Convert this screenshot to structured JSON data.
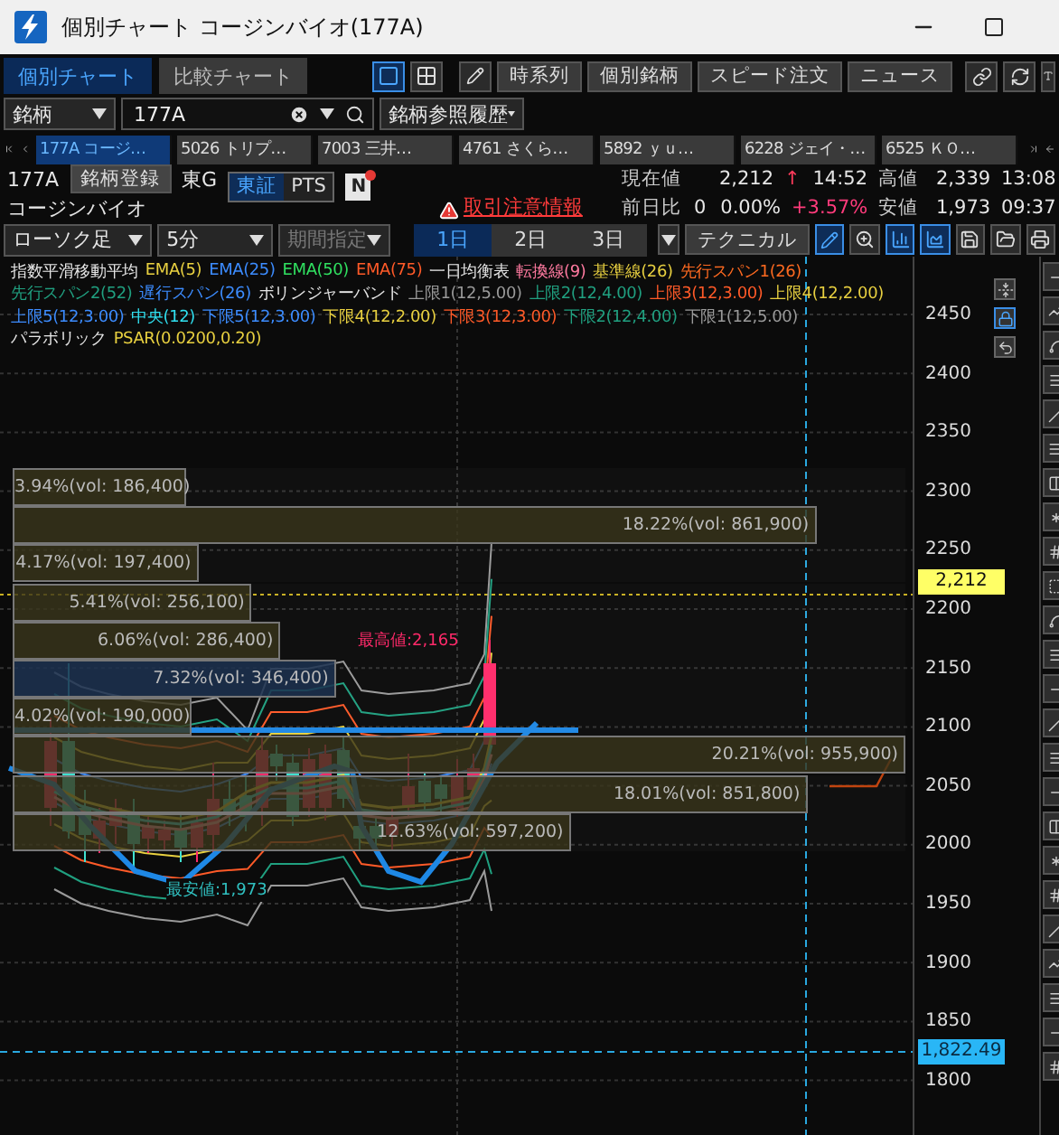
{
  "window": {
    "title": "個別チャート コージンバイオ(177A)"
  },
  "view_tabs": [
    {
      "label": "個別チャート",
      "selected": true
    },
    {
      "label": "比較チャート",
      "selected": false
    }
  ],
  "layout_modes": [
    {
      "kind": "single",
      "selected": true
    },
    {
      "kind": "grid",
      "selected": false
    }
  ],
  "toolbar_buttons": [
    "時系列",
    "個別銘柄",
    "スピード注文",
    "ニュース"
  ],
  "symbol_bar": {
    "search_type": "銘柄",
    "symbol": "177A",
    "history": "銘柄参照履歴"
  },
  "stock_tabs": [
    {
      "label": "177A コージ…",
      "selected": true
    },
    {
      "label": "5026 トリプ…",
      "selected": false
    },
    {
      "label": "7003 三井…",
      "selected": false
    },
    {
      "label": "4761 さくら…",
      "selected": false
    },
    {
      "label": "5892 ｙｕ…",
      "selected": false
    },
    {
      "label": "6228 ジェイ・…",
      "selected": false
    },
    {
      "label": "6525 ＫＯ…",
      "selected": false
    }
  ],
  "quote": {
    "code": "177A",
    "register_button": "銘柄登録",
    "market": "東G",
    "exchanges": [
      {
        "label": "東証",
        "selected": true
      },
      {
        "label": "PTS",
        "selected": false
      }
    ],
    "news_badge": "N",
    "name": "コージンバイオ",
    "notice": "取引注意情報",
    "price": {
      "label": "現在値",
      "value": "2,212",
      "arrow": "↑",
      "time": "14:52"
    },
    "high": {
      "label": "高値",
      "value": "2,339",
      "time": "13:08"
    },
    "change": {
      "label": "前日比",
      "value": "0",
      "percent": "0.00%",
      "rate": "+3.57%"
    },
    "low": {
      "label": "安値",
      "value": "1,973",
      "time": "09:37"
    }
  },
  "chart_controls": {
    "chart_type": "ローソク足",
    "interval": "5分",
    "period": {
      "label": "期間指定",
      "disabled": true
    },
    "ranges": [
      {
        "label": "1日",
        "selected": true
      },
      {
        "label": "2日",
        "selected": false
      },
      {
        "label": "3日",
        "selected": false
      }
    ],
    "technical": "テクニカル"
  },
  "legend_rows": [
    [
      {
        "text": "指数平滑移動平均",
        "color": "#e6e6e6"
      },
      {
        "text": "EMA(5)",
        "color": "#e8d040"
      },
      {
        "text": "EMA(25)",
        "color": "#3c8cff"
      },
      {
        "text": "EMA(50)",
        "color": "#30e060"
      },
      {
        "text": "EMA(75)",
        "color": "#ff5a28"
      },
      {
        "text": "一日均衡表",
        "color": "#e6e6e6"
      },
      {
        "text": "転換線(9)",
        "color": "#ff7aa0"
      },
      {
        "text": "基準線(26)",
        "color": "#e8d040"
      },
      {
        "text": "先行スパン1(26)",
        "color": "#ff6a20"
      }
    ],
    [
      {
        "text": "先行スパン2(52)",
        "color": "#20a080"
      },
      {
        "text": "遅行スパン(26)",
        "color": "#3c8cff"
      },
      {
        "text": "ボリンジャーバンド",
        "color": "#e6e6e6"
      },
      {
        "text": "上限1(12,5.00)",
        "color": "#9a9a9a"
      },
      {
        "text": "上限2(12,4.00)",
        "color": "#20a080"
      },
      {
        "text": "上限3(12,3.00)",
        "color": "#ff5a28"
      },
      {
        "text": "上限4(12,2.00)",
        "color": "#e8d040"
      }
    ],
    [
      {
        "text": "上限5(12,3.00)",
        "color": "#3c8cff"
      },
      {
        "text": "中央(12)",
        "color": "#30e0f0"
      },
      {
        "text": "下限5(12,3.00)",
        "color": "#3c8cff"
      },
      {
        "text": "下限4(12,2.00)",
        "color": "#e8d040"
      },
      {
        "text": "下限3(12,3.00)",
        "color": "#ff5a28"
      },
      {
        "text": "下限2(12,4.00)",
        "color": "#20a080"
      },
      {
        "text": "下限1(12,5.00)",
        "color": "#9a9a9a"
      }
    ],
    [
      {
        "text": "パラボリック",
        "color": "#e6e6e6"
      },
      {
        "text": "PSAR(0.0200,0.20)",
        "color": "#e8d040"
      }
    ]
  ],
  "price_axis": [
    "2450",
    "2400",
    "2350",
    "2300",
    "2250",
    "2200",
    "2150",
    "2100",
    "2050",
    "2000",
    "1950",
    "1900",
    "1850",
    "1800"
  ],
  "volume_profile": [
    {
      "label": "3.94%(vol: 186,400)",
      "level": 0.195,
      "selected": false
    },
    {
      "label": "18.22%(vol: 861,900)",
      "level": 0.9,
      "selected": false
    },
    {
      "label": "4.17%(vol: 197,400)",
      "level": 0.208,
      "selected": false
    },
    {
      "label": "5.41%(vol: 256,100)",
      "level": 0.268,
      "selected": false
    },
    {
      "label": "6.06%(vol: 286,400)",
      "level": 0.3,
      "selected": false
    },
    {
      "label": "7.32%(vol: 346,400)",
      "level": 0.362,
      "selected": true
    },
    {
      "label": "4.02%(vol: 190,000)",
      "level": 0.2,
      "selected": false
    },
    {
      "label": "20.21%(vol: 955,900)",
      "level": 1.0,
      "selected": false
    },
    {
      "label": "18.01%(vol: 851,800)",
      "level": 0.89,
      "selected": false
    },
    {
      "label": "12.63%(vol: 597,200)",
      "level": 0.625,
      "selected": false
    }
  ],
  "annotations": {
    "high": "最高値:2,165",
    "low": "最安値:1,973"
  },
  "markers": {
    "current": "2,212",
    "cursor": "1,822.49"
  }
}
